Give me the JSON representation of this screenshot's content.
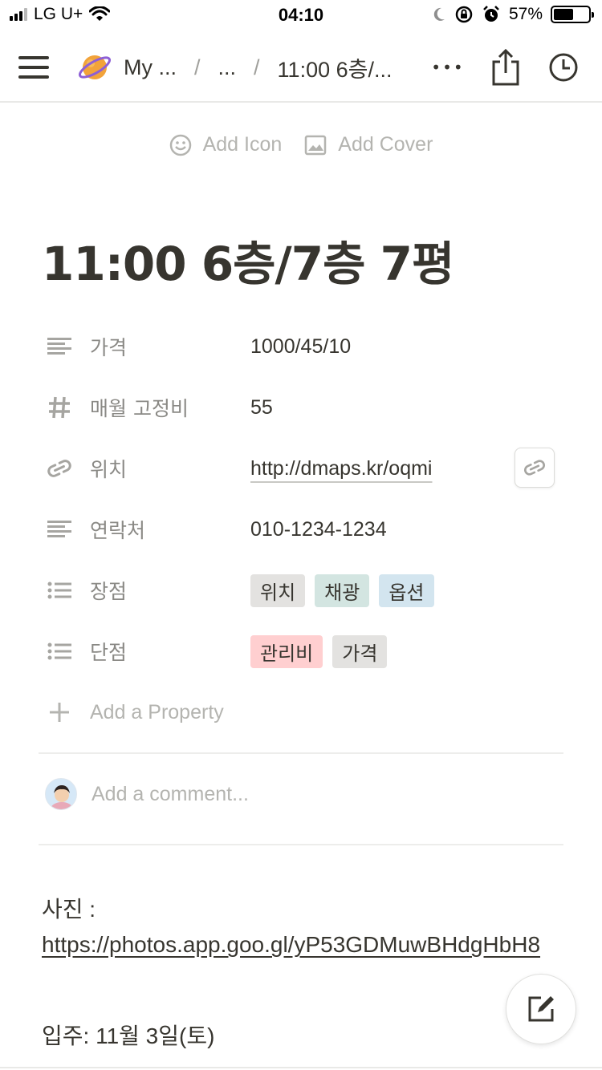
{
  "status_bar": {
    "carrier": "LG U+",
    "time": "04:10",
    "battery_percent": "57%",
    "battery_level": 0.57
  },
  "nav": {
    "breadcrumb_workspace": "My ...",
    "breadcrumb_middle": "...",
    "breadcrumb_page": "11:00 6층/...",
    "separator": "/",
    "more_label": "•••"
  },
  "page_actions": {
    "add_icon": "Add Icon",
    "add_cover": "Add Cover"
  },
  "title": "11:00 6층/7층 7평",
  "properties": [
    {
      "icon": "text-lines-icon",
      "name": "가격",
      "value": "1000/45/10"
    },
    {
      "icon": "number-hash-icon",
      "name": "매월 고정비",
      "value": "55"
    },
    {
      "icon": "url-link-icon",
      "name": "위치",
      "value": "http://dmaps.kr/oqmi"
    },
    {
      "icon": "text-lines-icon",
      "name": "연락처",
      "value": "010-1234-1234"
    },
    {
      "icon": "multi-select-list-icon",
      "name": "장점",
      "tags": [
        {
          "label": "위치",
          "color": "gray"
        },
        {
          "label": "채광",
          "color": "green"
        },
        {
          "label": "옵션",
          "color": "blue"
        }
      ]
    },
    {
      "icon": "multi-select-list-icon",
      "name": "단점",
      "tags": [
        {
          "label": "관리비",
          "color": "red"
        },
        {
          "label": "가격",
          "color": "gray"
        }
      ]
    }
  ],
  "add_property": "Add a Property",
  "comment_placeholder": "Add a comment...",
  "body": {
    "photo_label": "사진 :",
    "photo_url": "https://photos.app.goo.gl/yP53GDMuwBHdgHbH8",
    "move_in": "입주: 11월 3일(토)"
  },
  "colors": {
    "text": "#37352f",
    "muted": "#8a8985",
    "placeholder": "#b4b4b0",
    "tag_gray": "#e3e2e0",
    "tag_green": "#d3e5e1",
    "tag_blue": "#d3e5ef",
    "tag_red": "#ffcfd0",
    "planet": "#f2a33a"
  }
}
